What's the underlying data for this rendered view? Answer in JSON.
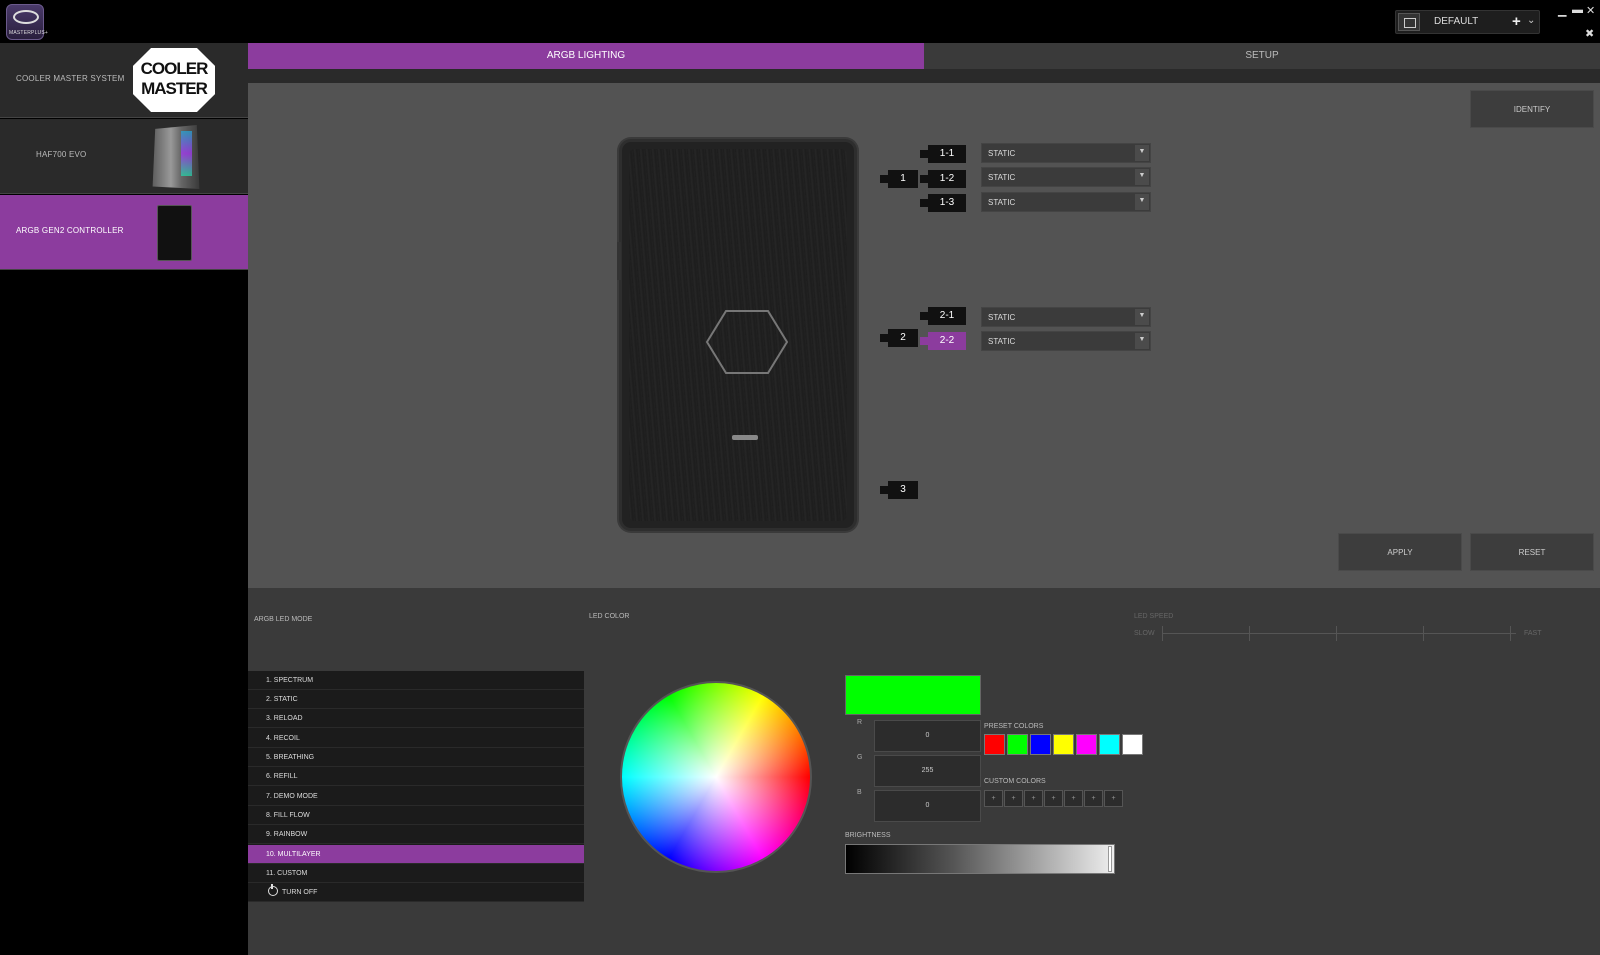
{
  "app": {
    "logo_text": "MASTERPLUS+"
  },
  "header": {
    "profile_name": "DEFAULT",
    "plus": "+",
    "chevron": "⌄",
    "minimize": "▁",
    "maximize": "▬",
    "close": "✕",
    "pin": "✖"
  },
  "sidebar": {
    "items": [
      {
        "label": "COOLER MASTER SYSTEM",
        "logo_line1": "COOLER",
        "logo_line2": "MASTER"
      },
      {
        "label": "HAF700 EVO"
      },
      {
        "label": "ARGB GEN2 CONTROLLER"
      }
    ]
  },
  "tabs": {
    "active": "ARGB LIGHTING",
    "inactive": "SETUP"
  },
  "panel": {
    "identify": "IDENTIFY",
    "apply": "APPLY",
    "reset": "RESET",
    "ports": [
      {
        "label": "1"
      },
      {
        "label": "2"
      },
      {
        "label": "3"
      }
    ],
    "subports": [
      {
        "label": "1-1",
        "mode": "STATIC"
      },
      {
        "label": "1-2",
        "mode": "STATIC"
      },
      {
        "label": "1-3",
        "mode": "STATIC"
      },
      {
        "label": "2-1",
        "mode": "STATIC"
      },
      {
        "label": "2-2",
        "mode": "STATIC"
      }
    ],
    "dropdown_arrow": "▼"
  },
  "bottom": {
    "mode_label": "ARGB LED MODE",
    "color_label": "LED COLOR",
    "speed_label": "LED SPEED",
    "speed_slow": "SLOW",
    "speed_fast": "FAST",
    "modes": [
      "1. SPECTRUM",
      "2. STATIC",
      "3. RELOAD",
      "4. RECOIL",
      "5. BREATHING",
      "6. REFILL",
      "7. DEMO MODE",
      "8. FILL FLOW",
      "9. RAINBOW",
      "10. MULTILAYER",
      "11. CUSTOM",
      "TURN OFF"
    ],
    "active_mode": "10. MULTILAYER",
    "rgb": {
      "r_label": "R",
      "r": "0",
      "g_label": "G",
      "g": "255",
      "b_label": "B",
      "b": "0"
    },
    "current_color": "#00ff00",
    "preset_label": "PRESET COLORS",
    "preset_colors": [
      "#ff0000",
      "#00ff00",
      "#0000ff",
      "#ffff00",
      "#ff00ff",
      "#00ffff",
      "#ffffff"
    ],
    "custom_label": "CUSTOM COLORS",
    "custom_slot": "+",
    "brightness_label": "BRIGHTNESS",
    "brightness": 1.0
  },
  "colors": {
    "accent": "#8c3c9e"
  }
}
